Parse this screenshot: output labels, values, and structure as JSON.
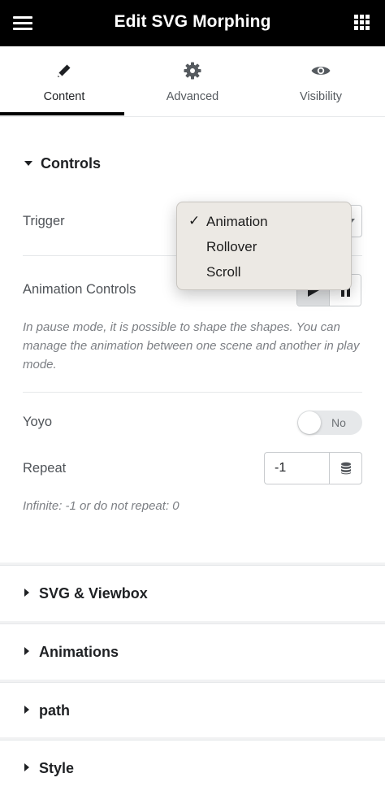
{
  "header": {
    "title": "Edit SVG Morphing",
    "menu_icon": "hamburger-menu-icon",
    "apps_icon": "grid-apps-icon"
  },
  "tabs": [
    {
      "label": "Content",
      "icon": "pencil-icon",
      "active": true
    },
    {
      "label": "Advanced",
      "icon": "gear-icon",
      "active": false
    },
    {
      "label": "Visibility",
      "icon": "eye-icon",
      "active": false
    }
  ],
  "controls": {
    "title": "Controls",
    "trigger_label": "Trigger",
    "trigger_options": [
      "Animation",
      "Rollover",
      "Scroll"
    ],
    "trigger_selected": "Animation",
    "check_mark": "✓",
    "animation_controls_label": "Animation Controls",
    "animation_controls_help": "In pause mode, it is possible to shape the shapes. You can manage the animation between one scene and another in play mode.",
    "yoyo_label": "Yoyo",
    "yoyo_state": "No",
    "repeat_label": "Repeat",
    "repeat_value": "-1",
    "repeat_help": "Infinite: -1 or do not repeat: 0"
  },
  "panels": [
    {
      "title": "SVG & Viewbox"
    },
    {
      "title": "Animations"
    },
    {
      "title": "path"
    },
    {
      "title": "Style"
    }
  ],
  "colors": {
    "header_bg": "#000000",
    "active_tab_underline": "#000000",
    "dropdown_bg": "#ece9e4"
  }
}
